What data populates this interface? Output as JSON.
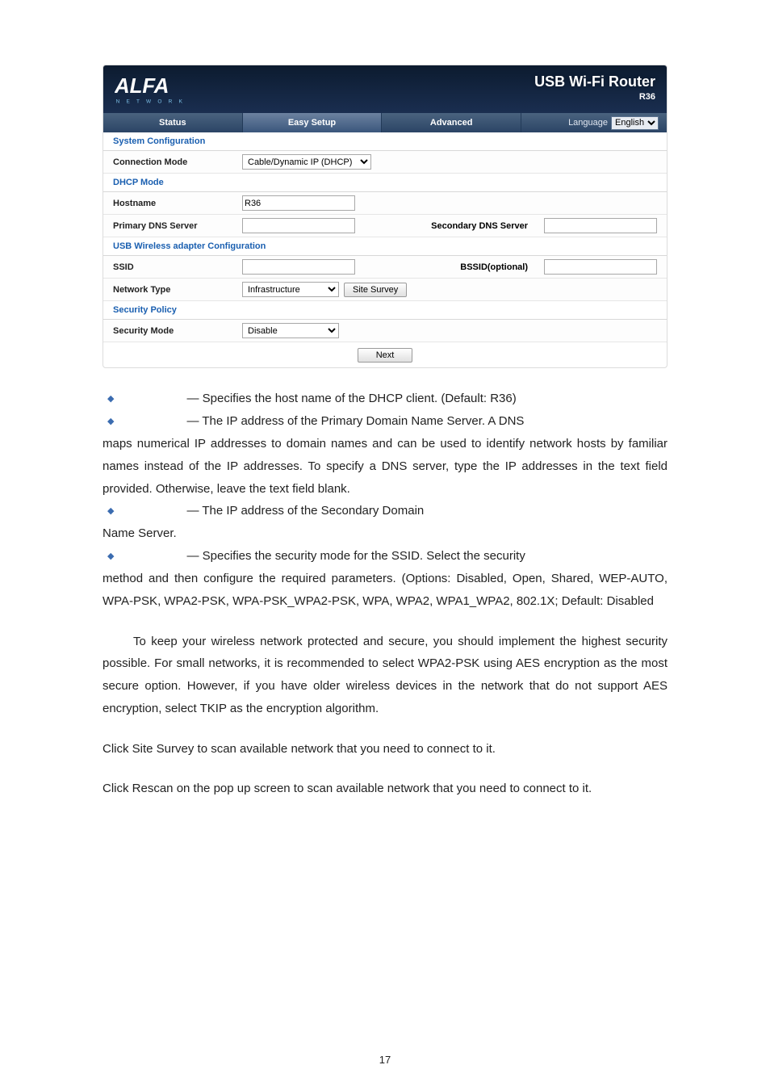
{
  "header": {
    "usb_title": "USB Wi-Fi Router",
    "model": "R36",
    "tab_status": "Status",
    "tab_easy": "Easy Setup",
    "tab_advanced": "Advanced",
    "language_label": "Language",
    "language_value": "English"
  },
  "sections": {
    "system_conf": "System Configuration",
    "dhcp_mode": "DHCP Mode",
    "usb_conf": "USB Wireless adapter Configuration",
    "security_policy": "Security Policy"
  },
  "rows": {
    "connection_mode_label": "Connection Mode",
    "connection_mode_value": "Cable/Dynamic IP (DHCP)",
    "hostname_label": "Hostname",
    "hostname_value": "R36",
    "primary_dns_label": "Primary DNS Server",
    "primary_dns_value": "",
    "secondary_dns_label": "Secondary DNS Server",
    "secondary_dns_value": "",
    "ssid_label": "SSID",
    "ssid_value": "",
    "bssid_label": "BSSID(optional)",
    "bssid_value": "",
    "network_type_label": "Network Type",
    "network_type_value": "Infrastructure",
    "site_survey_btn": "Site Survey",
    "security_mode_label": "Security Mode",
    "security_mode_value": "Disable",
    "next_btn": "Next"
  },
  "doc": {
    "b1": " — Specifies the host name of the DHCP client. (Default: R36)",
    "b2_l1": " — The IP address of the Primary Domain Name Server. A DNS",
    "b2_rest": "maps numerical IP addresses to domain names and can be used to identify network hosts by familiar names instead of the IP addresses. To specify a DNS server, type the IP addresses in the text field provided. Otherwise, leave the text field blank.",
    "b3_l1": " — The IP address of the Secondary Domain",
    "b3_rest": "Name Server.",
    "b4_l1": " — Specifies the security mode for the SSID. Select the security",
    "b4_rest": "method and then configure the required parameters. (Options: Disabled, Open, Shared, WEP-AUTO, WPA-PSK, WPA2-PSK, WPA-PSK_WPA2-PSK, WPA, WPA2, WPA1_WPA2, 802.1X; Default: Disabled",
    "p1": "To keep your wireless network protected and secure, you should implement the highest security possible. For small networks, it is recommended to select WPA2-PSK using AES encryption as the most secure option. However, if you have older wireless devices in the network that do not support AES encryption, select TKIP as the encryption algorithm.",
    "p2": "Click Site Survey to scan available network that you need to connect to it.",
    "p3": "Click Rescan on the pop up screen to scan available network that you need to connect to it.",
    "pagenum": "17"
  }
}
